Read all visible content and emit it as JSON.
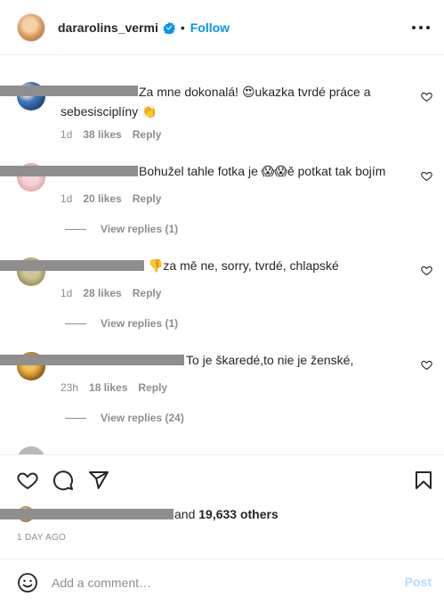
{
  "header": {
    "username": "dararolins_vermi",
    "separator": "•",
    "follow_label": "Follow",
    "verified_color": "#0095f6",
    "more_icon": "more-horizontal-icon"
  },
  "comments": [
    {
      "text": "Za mne dokonalá! 😍ukazka tvrdé práce a sebesisciplíny 👏",
      "time": "1d",
      "likes": "38 likes",
      "reply": "Reply"
    },
    {
      "text": "Bohužel tahle fotka je 😱😱ě potkat tak bojím",
      "time": "1d",
      "likes": "20 likes",
      "reply": "Reply",
      "view_replies": "View replies (1)"
    },
    {
      "text": "👎za mě ne, sorry, tvrdé, chlapské",
      "time": "1d",
      "likes": "28 likes",
      "reply": "Reply",
      "view_replies": "View replies (1)"
    },
    {
      "text": "To je škaredé,to nie je ženské,",
      "time": "23h",
      "likes": "18 likes",
      "reply": "Reply",
      "view_replies": "View replies (24)"
    }
  ],
  "likes_summary": {
    "connector": "and",
    "count": "19,633 others"
  },
  "date": "1 DAY AGO",
  "add_comment": {
    "placeholder": "Add a comment…",
    "post_label": "Post"
  },
  "colors": {
    "accent": "#0095f6",
    "post_disabled": "#b2dffc",
    "muted": "#8e8e8e",
    "text": "#262626"
  }
}
